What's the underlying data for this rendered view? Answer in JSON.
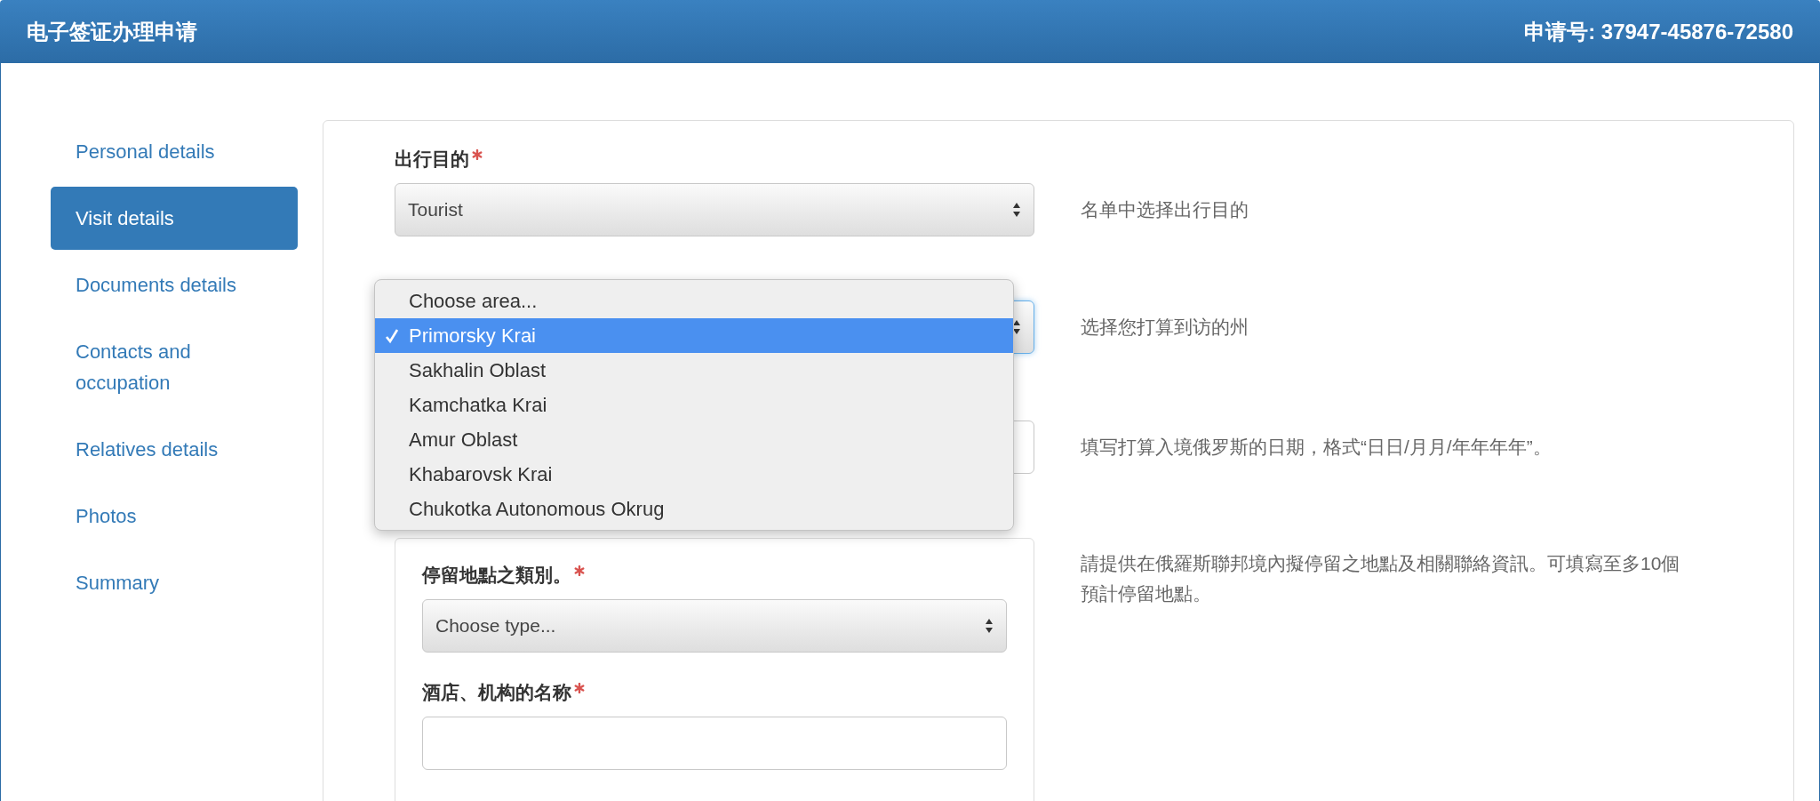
{
  "header": {
    "title": "电子签证办理申请",
    "application_number": "申请号: 37947-45876-72580"
  },
  "sidebar": {
    "items": [
      {
        "label": "Personal details",
        "selected": false
      },
      {
        "label": "Visit details",
        "selected": true
      },
      {
        "label": "Documents details",
        "selected": false
      },
      {
        "label": "Contacts and occupation",
        "selected": false
      },
      {
        "label": "Relatives details",
        "selected": false
      },
      {
        "label": "Photos",
        "selected": false
      },
      {
        "label": "Summary",
        "selected": false
      }
    ]
  },
  "form": {
    "fields": [
      {
        "kind": "select",
        "label": "出行目的",
        "required": true,
        "focused": false,
        "value": "Tourist",
        "help": "名单中选择出行目的"
      },
      {
        "kind": "select",
        "focused": true,
        "help": "选择您打算到访的州"
      },
      {
        "kind": "input",
        "help": "填写打算入境俄罗斯的日期，格式“日日/月月/年年年年”。"
      }
    ],
    "stay_section": {
      "help": "請提供在俄羅斯聯邦境內擬停留之地點及相關聯絡資訊。可填寫至多10個預計停留地點。",
      "fields": [
        {
          "kind": "select",
          "label": "停留地點之類別。",
          "required": true,
          "focused": false,
          "value": "Choose type..."
        },
        {
          "kind": "input",
          "label": "酒店、机构的名称",
          "required": true
        }
      ]
    }
  },
  "dropdown": {
    "options": [
      {
        "label": "Choose area...",
        "selected": false
      },
      {
        "label": "Primorsky Krai",
        "selected": true
      },
      {
        "label": "Sakhalin Oblast",
        "selected": false
      },
      {
        "label": "Kamchatka Krai",
        "selected": false
      },
      {
        "label": "Amur Oblast",
        "selected": false
      },
      {
        "label": "Khabarovsk Krai",
        "selected": false
      },
      {
        "label": "Chukotka Autonomous Okrug",
        "selected": false
      }
    ]
  }
}
